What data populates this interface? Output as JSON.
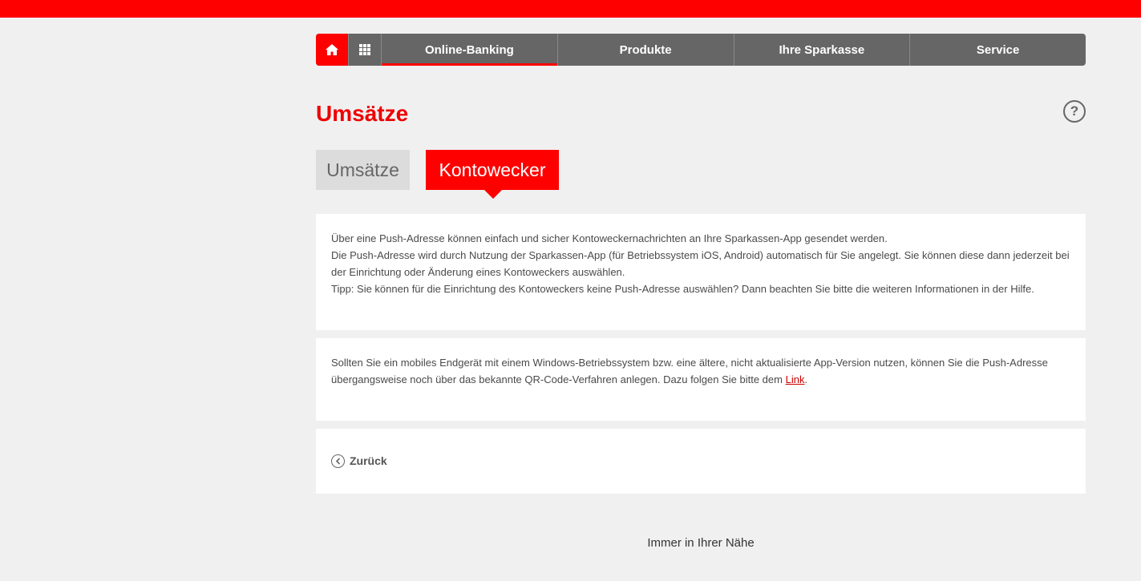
{
  "colors": {
    "brand": "#ff0000",
    "nav_bg": "#666666",
    "page_bg": "#f0f0f0"
  },
  "nav": {
    "home_icon": "home-icon",
    "grid_icon": "grid-icon",
    "items": [
      "Online-Banking",
      "Produkte",
      "Ihre Sparkasse",
      "Service"
    ],
    "active": "Online-Banking"
  },
  "page": {
    "title": "Umsätze",
    "help_label": "?"
  },
  "tabs": [
    {
      "label": "Umsätze",
      "active": false
    },
    {
      "label": "Kontowecker",
      "active": true
    }
  ],
  "info": {
    "line1": "Über eine Push-Adresse können einfach und sicher Kontoweckernachrichten an Ihre Sparkassen-App gesendet werden.",
    "line2": "Die Push-Adresse wird durch Nutzung der Sparkassen-App (für Betriebssystem iOS, Android) automatisch für Sie angelegt. Sie können diese dann jederzeit bei der Einrichtung oder Änderung eines Kontoweckers auswählen.",
    "line3": "Tipp: Sie können für die Einrichtung des Kontoweckers keine Push-Adresse auswählen? Dann beachten Sie bitte die weiteren Informationen in der Hilfe."
  },
  "legacy": {
    "text": "Sollten Sie ein mobiles Endgerät mit einem Windows-Betriebssystem bzw. eine ältere, nicht aktualisierte App-Version nutzen, können Sie die Push-Adresse übergangsweise noch über das bekannte QR-Code-Verfahren anlegen. Dazu folgen Sie bitte dem",
    "link_label": "Link",
    "suffix": "."
  },
  "back": {
    "label": "Zurück"
  },
  "footer": {
    "tagline": "Immer in Ihrer Nähe"
  }
}
